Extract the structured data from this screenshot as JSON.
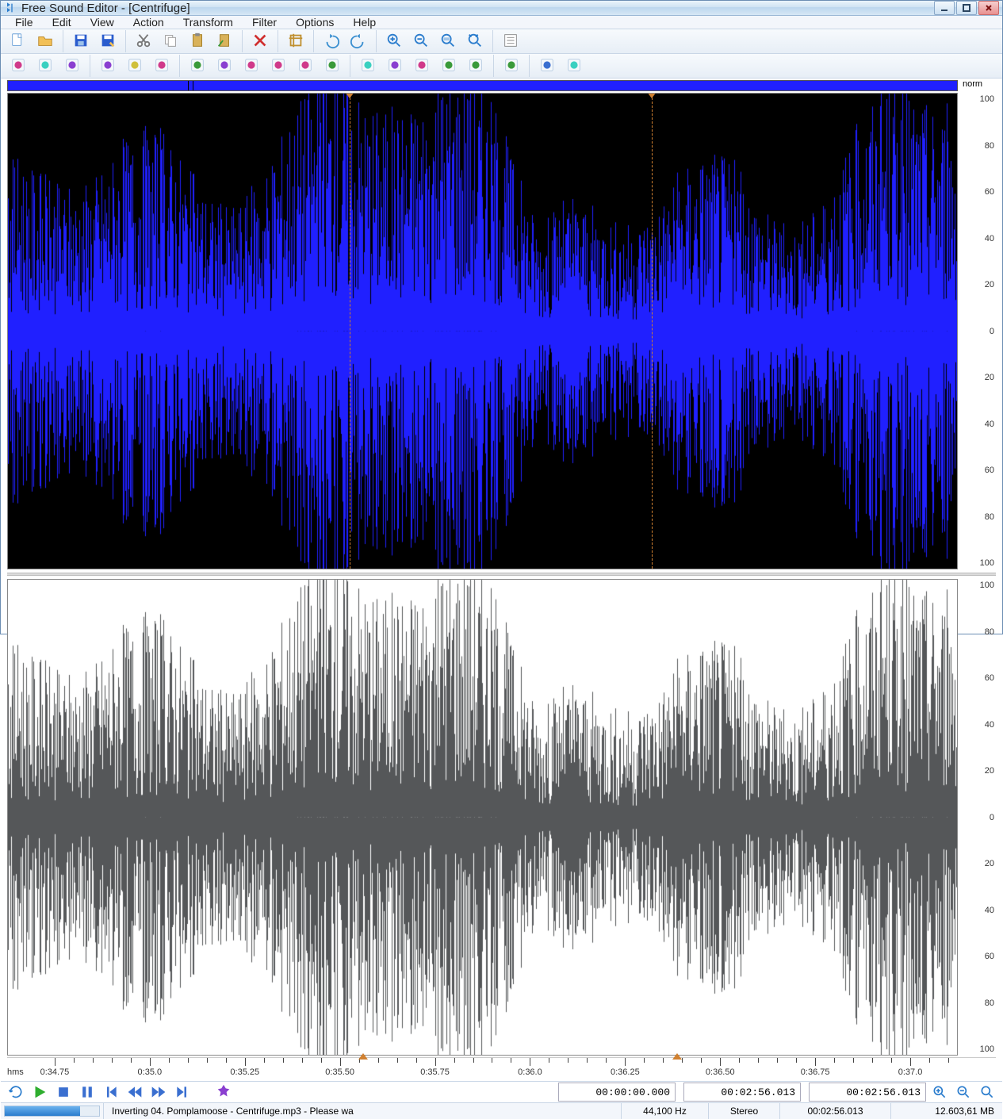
{
  "window": {
    "title": "Free Sound Editor - [Centrifuge]"
  },
  "menu": {
    "items": [
      "File",
      "Edit",
      "View",
      "Action",
      "Transform",
      "Filter",
      "Options",
      "Help"
    ]
  },
  "toolbar1": {
    "buttons": [
      {
        "name": "new-file-icon"
      },
      {
        "name": "open-file-icon"
      },
      {
        "sep": true
      },
      {
        "name": "save-icon"
      },
      {
        "name": "save-as-icon"
      },
      {
        "sep": true
      },
      {
        "name": "cut-icon"
      },
      {
        "name": "copy-icon"
      },
      {
        "name": "paste-icon"
      },
      {
        "name": "paste-mix-icon"
      },
      {
        "sep": true
      },
      {
        "name": "delete-icon"
      },
      {
        "sep": true
      },
      {
        "name": "crop-icon"
      },
      {
        "sep": true
      },
      {
        "name": "undo-icon"
      },
      {
        "name": "redo-icon"
      },
      {
        "sep": true
      },
      {
        "name": "zoom-in-icon"
      },
      {
        "name": "zoom-out-icon"
      },
      {
        "name": "zoom-selection-icon"
      },
      {
        "name": "zoom-full-icon"
      },
      {
        "sep": true
      },
      {
        "name": "properties-icon"
      }
    ]
  },
  "toolbar2": {
    "buttons": [
      {
        "name": "select-all-icon"
      },
      {
        "name": "effect1-icon"
      },
      {
        "name": "effect2-icon"
      },
      {
        "sep": true
      },
      {
        "name": "record-icon"
      },
      {
        "name": "mixer-icon"
      },
      {
        "name": "export-icon"
      },
      {
        "sep": true
      },
      {
        "name": "amplify-icon"
      },
      {
        "name": "fade-icon"
      },
      {
        "name": "eq-icon"
      },
      {
        "name": "mute-icon"
      },
      {
        "name": "crossfade-icon"
      },
      {
        "name": "filter-icon"
      },
      {
        "sep": true
      },
      {
        "name": "timer-icon"
      },
      {
        "name": "picture-icon"
      },
      {
        "name": "cloud-icon"
      },
      {
        "name": "ripple-icon"
      },
      {
        "name": "group-icon"
      },
      {
        "sep": true
      },
      {
        "name": "tool-a-icon"
      },
      {
        "sep": true
      },
      {
        "name": "tool-b-icon"
      },
      {
        "name": "tool-c-icon"
      }
    ]
  },
  "scale": {
    "norm": "norm",
    "ticks": [
      "100",
      "80",
      "60",
      "40",
      "20",
      "0",
      "20",
      "40",
      "60",
      "80",
      "100"
    ]
  },
  "timeline": {
    "hms": "hms",
    "labels": [
      "0:34.75",
      "0:35.0",
      "0:35.25",
      "0:35.50",
      "0:35.75",
      "0:36.0",
      "0:36.25",
      "0:36.50",
      "0:36.75",
      "0:37.0"
    ]
  },
  "selection": {
    "start_pct": 36.0,
    "end_pct": 67.8
  },
  "transport": {
    "time1": "00:00:00.000",
    "time2": "00:02:56.013",
    "time3": "00:02:56.013"
  },
  "status": {
    "progress_pct": 80,
    "task": "Inverting 04. Pomplamoose - Centrifuge.mp3 - Please wa",
    "sample_rate": "44,100 Hz",
    "channels": "Stereo",
    "duration": "00:02:56.013",
    "file_size": "12.603,61 MB"
  },
  "colors": {
    "titlebar_top": "#eaf3fb",
    "waveform_selected": "#2020ff",
    "waveform_unselected": "#555759",
    "selection_marker": "#d08030"
  }
}
